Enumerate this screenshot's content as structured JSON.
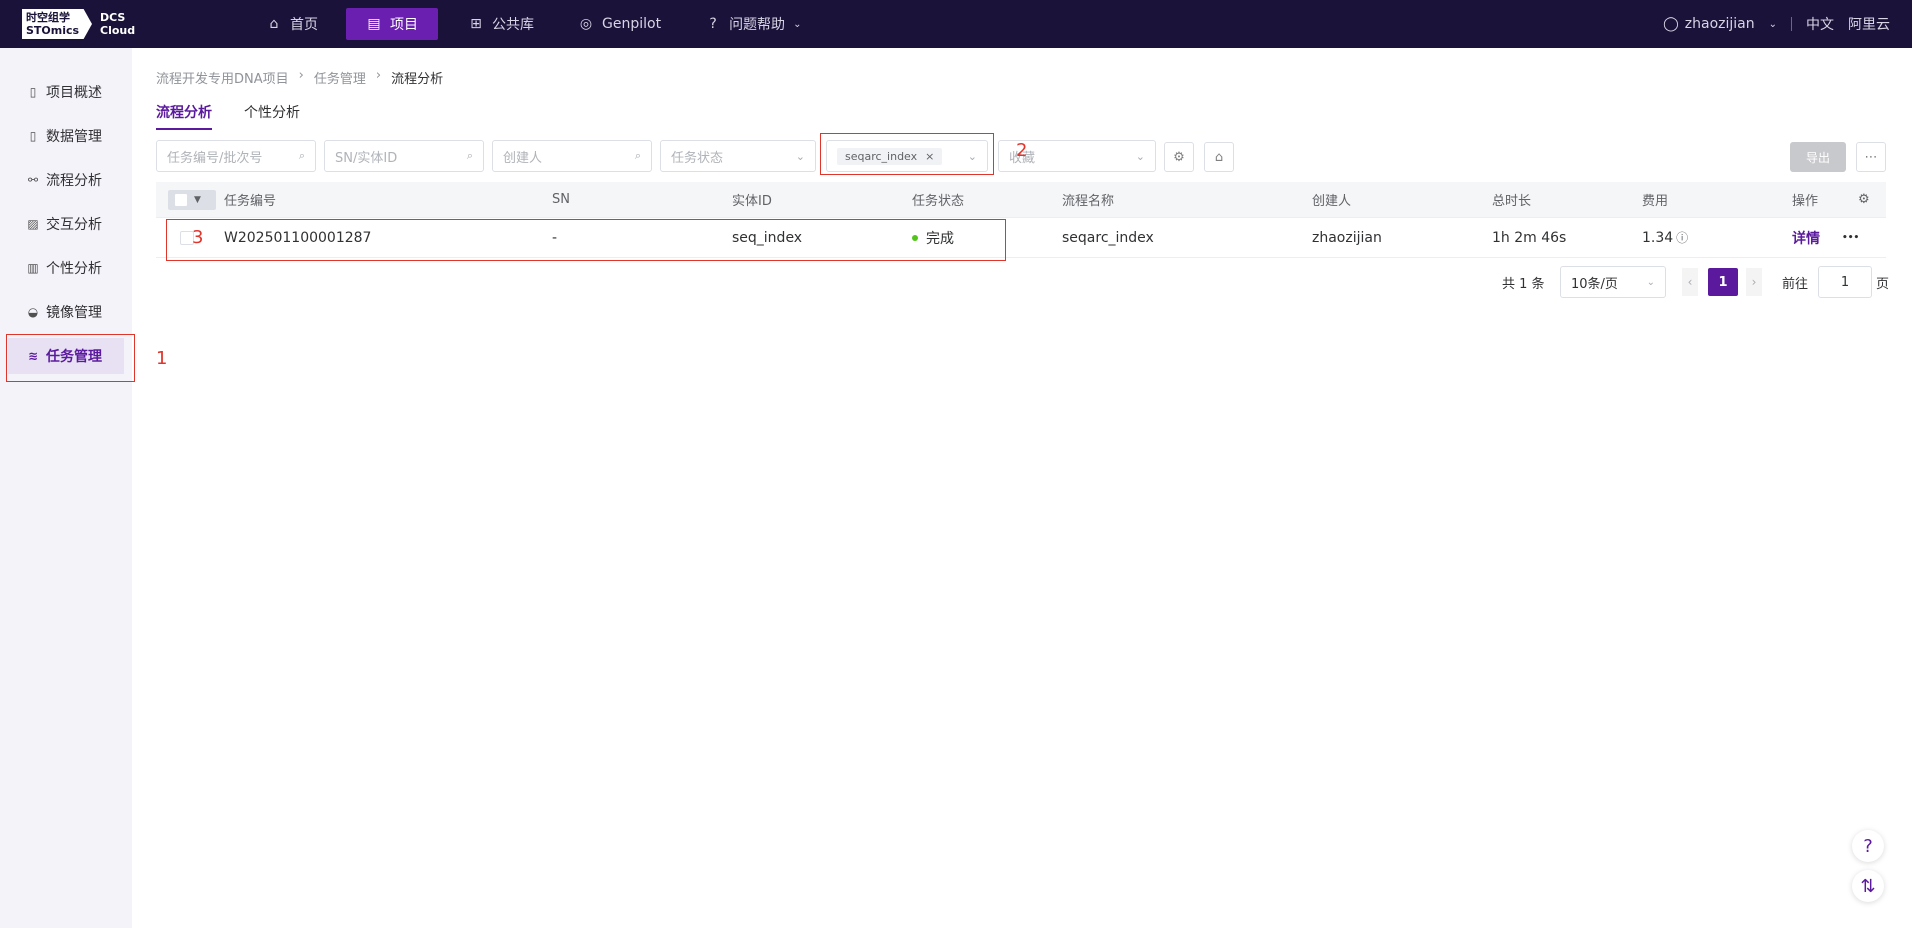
{
  "header": {
    "logo_cn": "时空组学",
    "logo_en": "STOmics",
    "logo_dcs": "DCS",
    "logo_cloud": "Cloud",
    "nav": [
      {
        "label": "首页",
        "icon": "home-icon"
      },
      {
        "label": "项目",
        "icon": "file-icon"
      },
      {
        "label": "公共库",
        "icon": "grid-icon"
      },
      {
        "label": "Genpilot",
        "icon": "globe-icon"
      },
      {
        "label": "问题帮助",
        "icon": "help-icon"
      }
    ],
    "user": "zhaozijian",
    "lang": "中文",
    "cloud": "阿里云"
  },
  "sidebar": {
    "items": [
      {
        "label": "项目概述"
      },
      {
        "label": "数据管理"
      },
      {
        "label": "流程分析"
      },
      {
        "label": "交互分析"
      },
      {
        "label": "个性分析"
      },
      {
        "label": "镜像管理"
      },
      {
        "label": "任务管理"
      }
    ]
  },
  "breadcrumb": [
    "流程开发专用DNA项目",
    "任务管理",
    "流程分析"
  ],
  "tabs": [
    "流程分析",
    "个性分析"
  ],
  "filters": {
    "task_id_placeholder": "任务编号/批次号",
    "sn_placeholder": "SN/实体ID",
    "creator_placeholder": "创建人",
    "status_placeholder": "任务状态",
    "workflow_chip": "seqarc_index",
    "favorite_placeholder": "收藏",
    "export_label": "导出"
  },
  "table": {
    "headers": [
      "任务编号",
      "SN",
      "实体ID",
      "任务状态",
      "流程名称",
      "创建人",
      "总时长",
      "费用",
      "操作"
    ],
    "rows": [
      {
        "task_id": "W202501100001287",
        "sn": "-",
        "entity_id": "seq_index",
        "status": "完成",
        "workflow": "seqarc_index",
        "creator": "zhaozijian",
        "duration": "1h 2m 46s",
        "cost": "1.34",
        "action": "详情",
        "more": "•••"
      }
    ]
  },
  "pagination": {
    "total": "共 1 条",
    "page_size": "10条/页",
    "current": "1",
    "goto_label": "前往",
    "goto_value": "1",
    "goto_suffix": "页"
  },
  "annotations": [
    "1",
    "2",
    "3"
  ],
  "colors": {
    "brand": "#5b1a9e",
    "topbar": "#1a1238",
    "annotation": "#e0352b",
    "success": "#52c41a"
  }
}
